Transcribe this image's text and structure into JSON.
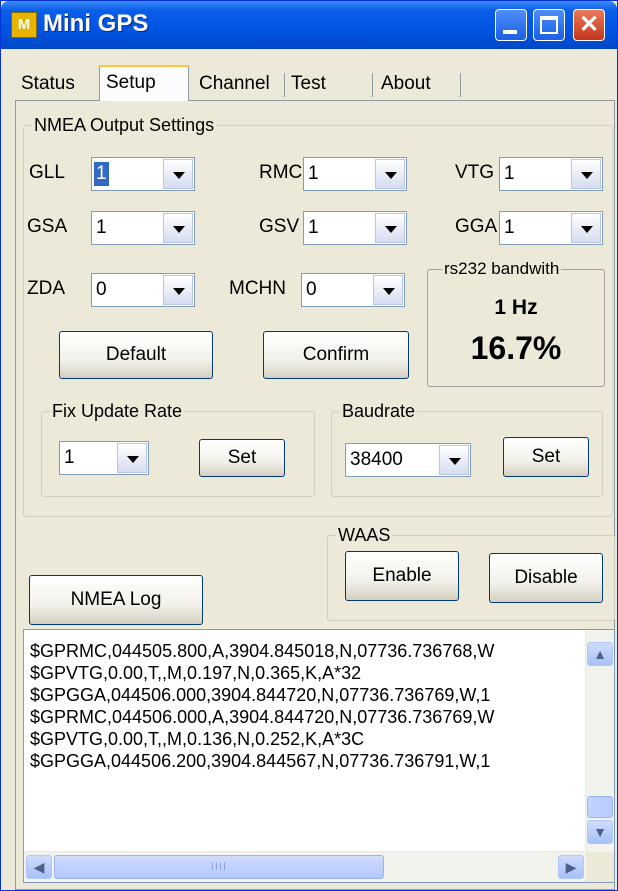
{
  "window": {
    "title": "Mini GPS",
    "app_icon_letter": "M",
    "close_glyph": "✕"
  },
  "tabs": [
    "Status",
    "Setup",
    "Channel",
    "Test",
    "About"
  ],
  "active_tab": "Setup",
  "nmea": {
    "group_label": "NMEA Output Settings",
    "fields": {
      "gll": {
        "label": "GLL",
        "value": "1"
      },
      "rmc": {
        "label": "RMC",
        "value": "1"
      },
      "vtg": {
        "label": "VTG",
        "value": "1"
      },
      "gsa": {
        "label": "GSA",
        "value": "1"
      },
      "gsv": {
        "label": "GSV",
        "value": "1"
      },
      "gga": {
        "label": "GGA",
        "value": "1"
      },
      "zda": {
        "label": "ZDA",
        "value": "0"
      },
      "mchn": {
        "label": "MCHN",
        "value": "0"
      }
    },
    "default_button": "Default",
    "confirm_button": "Confirm"
  },
  "bandwidth": {
    "label": "rs232 bandwith",
    "rate": "1 Hz",
    "percent": "16.7%"
  },
  "fix_update": {
    "label": "Fix Update Rate",
    "value": "1",
    "set_button": "Set"
  },
  "baudrate": {
    "label": "Baudrate",
    "value": "38400",
    "set_button": "Set"
  },
  "waas": {
    "label": "WAAS",
    "enable_button": "Enable",
    "disable_button": "Disable"
  },
  "nmea_log_button": "NMEA Log",
  "log_lines": [
    "$GPRMC,044505.800,A,3904.845018,N,07736.736768,W",
    "$GPVTG,0.00,T,,M,0.197,N,0.365,K,A*32",
    "$GPGGA,044506.000,3904.844720,N,07736.736769,W,1",
    "$GPRMC,044506.000,A,3904.844720,N,07736.736769,W",
    "$GPVTG,0.00,T,,M,0.136,N,0.252,K,A*3C",
    "$GPGGA,044506.200,3904.844567,N,07736.736791,W,1"
  ],
  "scroll": {
    "up": "▲",
    "down": "▼",
    "left": "◀",
    "right": "▶",
    "grip": "IIII"
  }
}
